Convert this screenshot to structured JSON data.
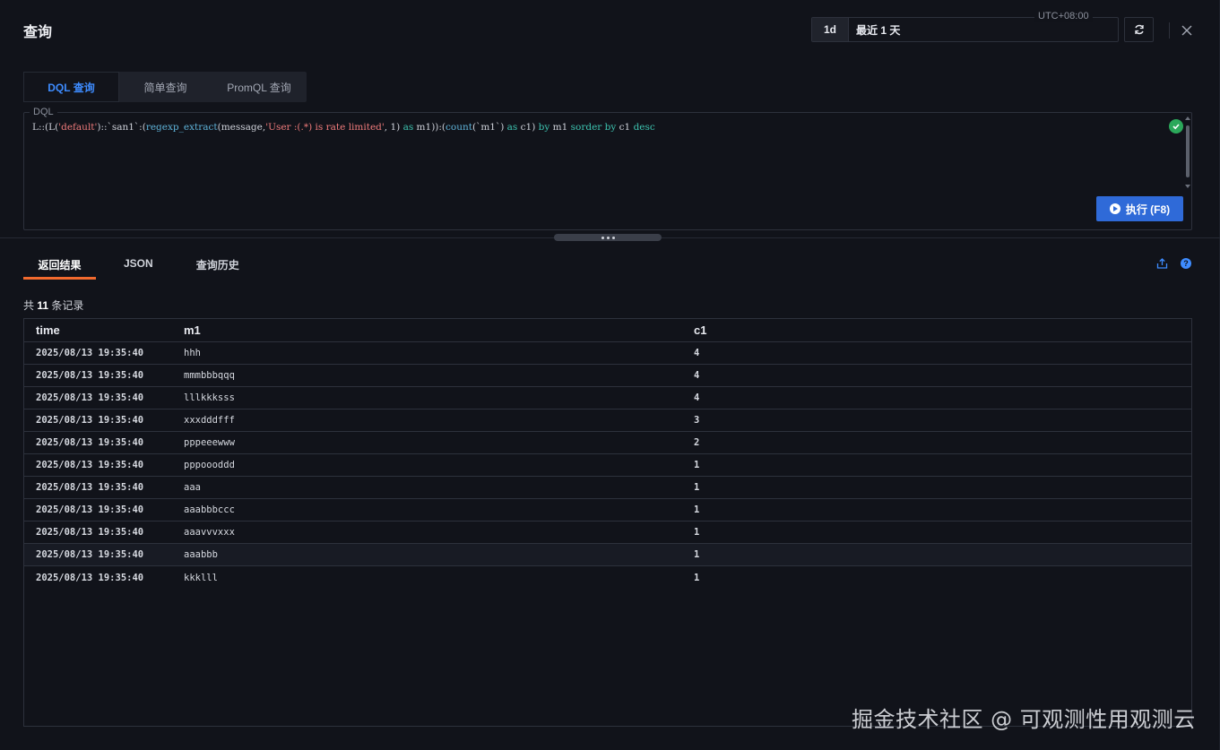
{
  "header": {
    "title": "查询",
    "timezone": "UTC+08:00",
    "time_short": "1d",
    "time_label": "最近 1 天"
  },
  "query_tabs": [
    {
      "label": "DQL 查询",
      "active": true
    },
    {
      "label": "简单查询",
      "active": false
    },
    {
      "label": "PromQL 查询",
      "active": false
    }
  ],
  "editor": {
    "legend": "DQL",
    "code_parts": {
      "p1": "L::(L(",
      "p2": "'default'",
      "p3": ")::`san1`:(",
      "p4": "regexp_extract",
      "p5": "(message,",
      "p6": "'User :(.*) is rate limited'",
      "p7": ", 1) ",
      "p8": "as",
      "p9": " m1)):(",
      "p10": "count",
      "p11": "(`m1`) ",
      "p12": "as",
      "p13": " c1) ",
      "p14": "by",
      "p15": " m1 ",
      "p16": "sorder by",
      "p17": " c1 ",
      "p18": "desc"
    },
    "run_label": "执行 (F8)"
  },
  "result_tabs": [
    {
      "label": "返回结果",
      "active": true
    },
    {
      "label": "JSON",
      "active": false
    },
    {
      "label": "查询历史",
      "active": false
    }
  ],
  "result": {
    "count_prefix": "共",
    "count_value": "11",
    "count_suffix": "条记录",
    "columns": [
      "time",
      "m1",
      "c1"
    ],
    "rows": [
      {
        "time": "2025/08/13 19:35:40",
        "m1": "hhh",
        "c1": "4"
      },
      {
        "time": "2025/08/13 19:35:40",
        "m1": "mmmbbbqqq",
        "c1": "4"
      },
      {
        "time": "2025/08/13 19:35:40",
        "m1": "lllkkksss",
        "c1": "4"
      },
      {
        "time": "2025/08/13 19:35:40",
        "m1": "xxxdddfff",
        "c1": "3"
      },
      {
        "time": "2025/08/13 19:35:40",
        "m1": "pppeeewww",
        "c1": "2"
      },
      {
        "time": "2025/08/13 19:35:40",
        "m1": "pppoooddd",
        "c1": "1"
      },
      {
        "time": "2025/08/13 19:35:40",
        "m1": "aaa",
        "c1": "1"
      },
      {
        "time": "2025/08/13 19:35:40",
        "m1": "aaabbbccc",
        "c1": "1"
      },
      {
        "time": "2025/08/13 19:35:40",
        "m1": "aaavvvxxx",
        "c1": "1"
      },
      {
        "time": "2025/08/13 19:35:40",
        "m1": "aaabbb",
        "c1": "1"
      },
      {
        "time": "2025/08/13 19:35:40",
        "m1": "kkklll",
        "c1": "1"
      }
    ]
  },
  "watermark": "掘金技术社区 @ 可观测性用观测云",
  "colors": {
    "accent": "#3e8cff",
    "active_tab_underline": "#f26a2e",
    "run_button": "#2f6ad8",
    "success": "#2ba85a"
  }
}
